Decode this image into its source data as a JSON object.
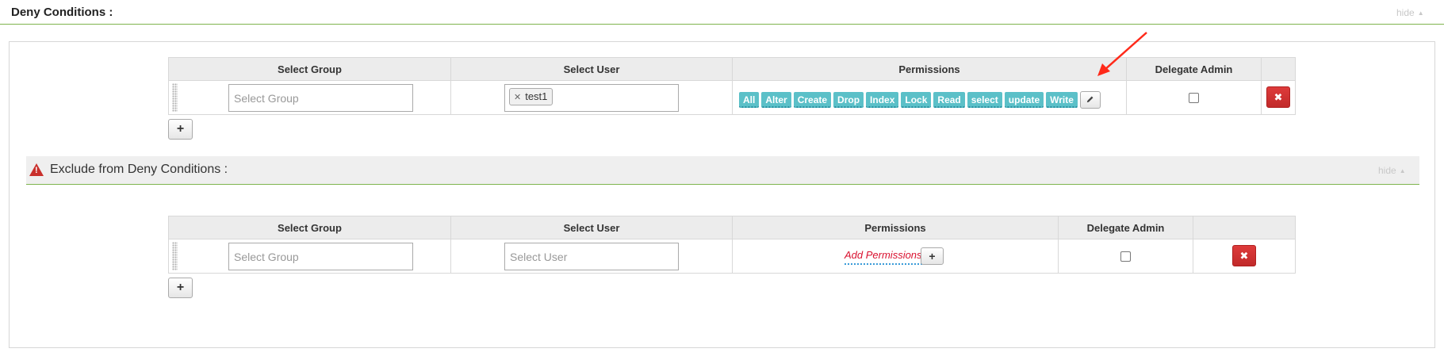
{
  "deny": {
    "title": "Deny Conditions :",
    "hide_label": "hide",
    "columns": [
      "Select Group",
      "Select User",
      "Permissions",
      "Delegate Admin",
      ""
    ],
    "row": {
      "group_placeholder": "Select Group",
      "user_tag": "test1",
      "permissions": [
        "All",
        "Alter",
        "Create",
        "Drop",
        "Index",
        "Lock",
        "Read",
        "select",
        "update",
        "Write"
      ],
      "delegate_admin": false
    }
  },
  "exclude": {
    "title": "Exclude from Deny Conditions :",
    "hide_label": "hide",
    "columns": [
      "Select Group",
      "Select User",
      "Permissions",
      "Delegate Admin",
      ""
    ],
    "row": {
      "group_placeholder": "Select Group",
      "user_placeholder": "Select User",
      "add_permissions_label": "Add Permissions",
      "delegate_admin": false
    }
  },
  "icons": {
    "add": "plus-icon",
    "edit": "pencil-icon",
    "delete": "times-icon",
    "warning": "warning-icon",
    "caret": "caret-up-icon"
  },
  "colors": {
    "accent_line": "#7fb44e",
    "permission_tag": "#5bc0c8",
    "delete_button": "#c9302c",
    "annotation_arrow": "#ff2a1a"
  }
}
